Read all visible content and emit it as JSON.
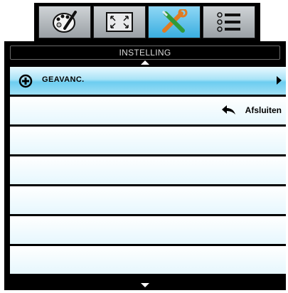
{
  "tabs": [
    {
      "icon": "palette-icon",
      "active": false
    },
    {
      "icon": "screen-resize-icon",
      "active": false
    },
    {
      "icon": "settings-tools-icon",
      "active": true
    },
    {
      "icon": "list-menu-icon",
      "active": false
    }
  ],
  "menu": {
    "title": "INSTELLING",
    "items": [
      {
        "label": "GEAVANC.",
        "selected": true
      },
      {
        "label": "Afsluiten"
      }
    ]
  },
  "colors": {
    "selected_row": "#6ccdf0",
    "active_tab": "#3aaee0"
  }
}
